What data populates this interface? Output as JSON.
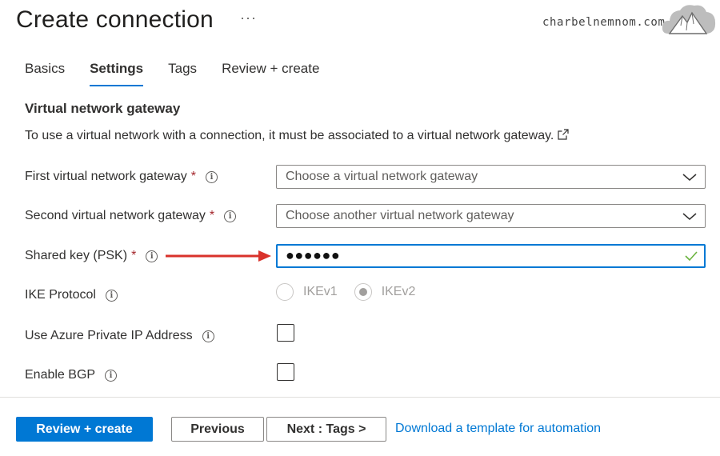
{
  "header": {
    "title": "Create connection",
    "more_label": "···",
    "watermark": "charbelnemnom.com",
    "logo_icon": "mountain-cloud-logo"
  },
  "tabs": [
    {
      "label": "Basics",
      "active": false
    },
    {
      "label": "Settings",
      "active": true
    },
    {
      "label": "Tags",
      "active": false
    },
    {
      "label": "Review + create",
      "active": false
    }
  ],
  "section": {
    "title": "Virtual network gateway",
    "description": "To use a virtual network with a connection, it must be associated to a virtual network gateway."
  },
  "fields": {
    "first_gateway": {
      "label": "First virtual network gateway",
      "required": "*",
      "placeholder": "Choose a virtual network gateway"
    },
    "second_gateway": {
      "label": "Second virtual network gateway",
      "required": "*",
      "placeholder": "Choose another virtual network gateway"
    },
    "shared_key": {
      "label": "Shared key (PSK)",
      "required": "*",
      "value": "●●●●●●"
    },
    "ike_protocol": {
      "label": "IKE Protocol",
      "options": [
        "IKEv1",
        "IKEv2"
      ],
      "selected": "IKEv2"
    },
    "private_ip": {
      "label": "Use Azure Private IP Address",
      "checked": false
    },
    "bgp": {
      "label": "Enable BGP",
      "checked": false
    }
  },
  "info_glyph": "i",
  "footer": {
    "review_create": "Review + create",
    "previous": "Previous",
    "next": "Next : Tags >",
    "download_link": "Download a template for automation"
  },
  "colors": {
    "accent": "#0078d4",
    "required": "#a4262c",
    "annotation_arrow": "#d9322b",
    "valid_check": "#6bb33f"
  }
}
